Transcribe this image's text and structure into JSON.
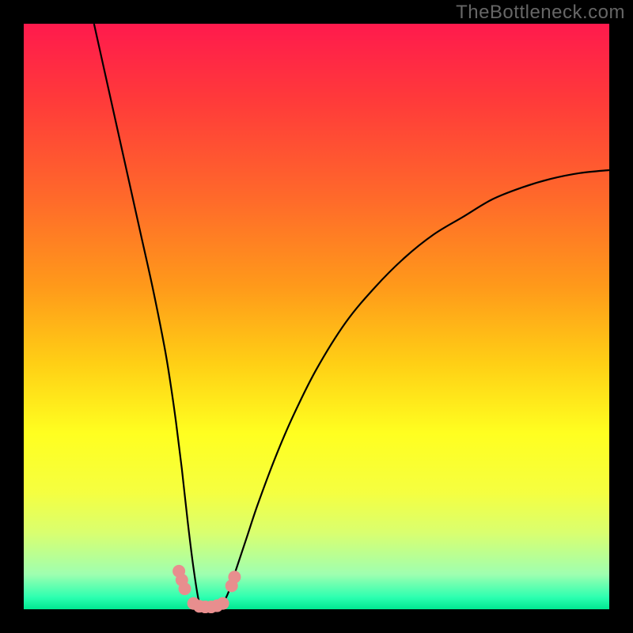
{
  "watermark": "TheBottleneck.com",
  "chart_data": {
    "type": "line",
    "title": "",
    "xlabel": "",
    "ylabel": "",
    "xlim": [
      0,
      100
    ],
    "ylim": [
      0,
      100
    ],
    "series": [
      {
        "name": "curve",
        "x": [
          12,
          14,
          16,
          18,
          20,
          22,
          24,
          25,
          26,
          27,
          28,
          29,
          30,
          31,
          32,
          33,
          34,
          35,
          36,
          38,
          40,
          43,
          46,
          50,
          55,
          60,
          65,
          70,
          75,
          80,
          85,
          90,
          95,
          100
        ],
        "y": [
          100,
          91,
          82,
          73,
          64,
          55,
          45,
          39,
          32,
          24,
          15,
          7,
          1,
          0,
          0,
          0,
          1,
          3,
          6,
          12,
          18,
          26,
          33,
          41,
          49,
          55,
          60,
          64,
          67,
          70,
          72,
          73.5,
          74.5,
          75
        ]
      }
    ],
    "markers": {
      "name": "highlight-points",
      "x": [
        26.5,
        27.0,
        27.5,
        29.0,
        30.0,
        31.0,
        32.0,
        33.0,
        34.0,
        35.5,
        36.0
      ],
      "y": [
        6.5,
        5.0,
        3.5,
        1.0,
        0.5,
        0.4,
        0.4,
        0.6,
        1.0,
        4.0,
        5.5
      ]
    },
    "background_gradient": {
      "top_color": "#ff1a4d",
      "bottom_color": "#00e890"
    }
  }
}
